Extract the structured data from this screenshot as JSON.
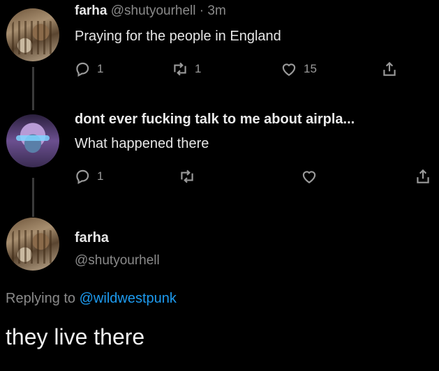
{
  "tweets": [
    {
      "name": "farha",
      "handle": "@shutyourhell",
      "separator": "·",
      "time": "3m",
      "text": "Praying for the people in England",
      "reply_count": "1",
      "retweet_count": "1",
      "like_count": "15"
    },
    {
      "quoted_title": "dont ever fucking talk to me about airpla...",
      "text": "What happened there",
      "reply_count": "1",
      "retweet_count": "",
      "like_count": ""
    }
  ],
  "focus": {
    "name": "farha",
    "handle": "@shutyourhell",
    "replying_prefix": "Replying to",
    "replying_mention": "@wildwestpunk",
    "text": "they live there"
  },
  "icons": {
    "reply": "reply-icon",
    "retweet": "retweet-icon",
    "like": "heart-icon",
    "share": "share-icon"
  },
  "colors": {
    "background": "#000000",
    "mention": "#1d9bf0",
    "muted": "#8a8a8a"
  }
}
